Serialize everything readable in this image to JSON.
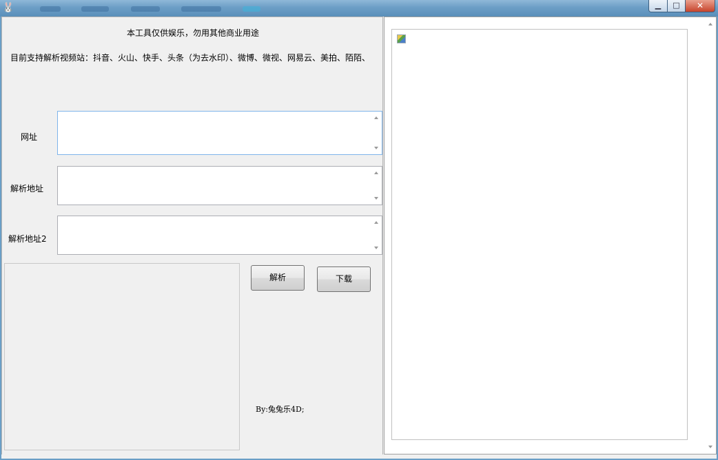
{
  "window": {
    "icon": "rabbit-app-icon",
    "controls": {
      "minimize": "minimize-icon",
      "maximize": "maximize-icon",
      "close": "close-icon"
    }
  },
  "header": {
    "disclaimer": "本工具仅供娱乐，勿用其他商业用途",
    "supported_sites": "目前支持解析视频站：抖音、火山、快手、头条（为去水印）、微博、微视、网易云、美拍、陌陌、"
  },
  "form": {
    "url_label": "网址",
    "url_value": "",
    "parsed_label": "解析地址",
    "parsed_value": "",
    "parsed2_label": "解析地址2",
    "parsed2_value": ""
  },
  "actions": {
    "parse_label": "解析",
    "download_label": "下载"
  },
  "footer": {
    "credit": "By:兔兔乐4D;"
  },
  "preview": {
    "image_icon": "broken-image-icon"
  }
}
